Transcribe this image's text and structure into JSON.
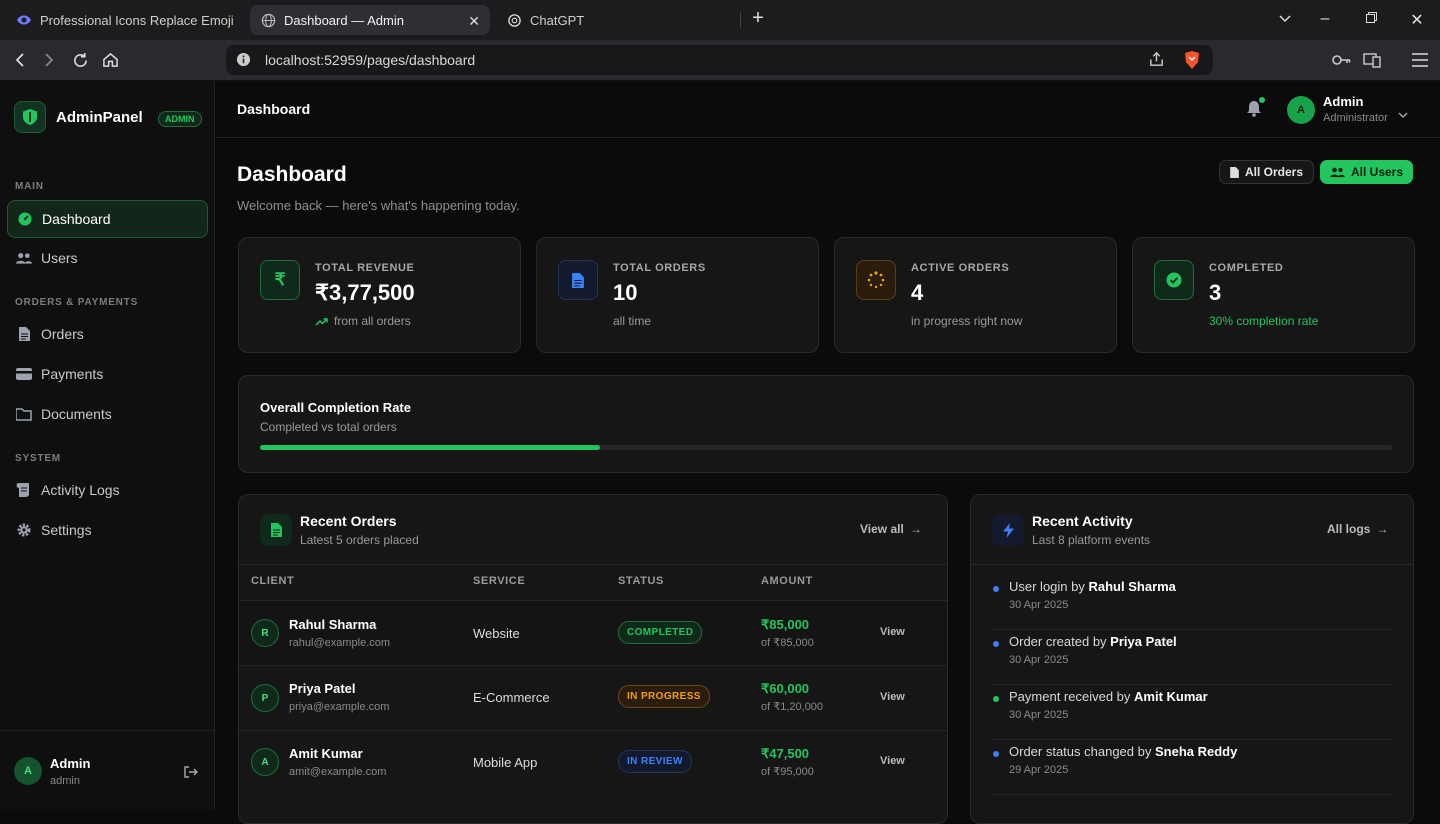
{
  "browser": {
    "tabs": [
      {
        "title": "Professional Icons Replace Emojis - D",
        "active": false
      },
      {
        "title": "Dashboard — Admin",
        "active": true
      },
      {
        "title": "ChatGPT",
        "active": false
      }
    ],
    "url": "localhost:52959/pages/dashboard"
  },
  "sidebar": {
    "brand": "AdminPanel",
    "badge": "ADMIN",
    "sections": {
      "main": "MAIN",
      "orders": "ORDERS & PAYMENTS",
      "system": "SYSTEM"
    },
    "items": {
      "dashboard": "Dashboard",
      "users": "Users",
      "orders": "Orders",
      "payments": "Payments",
      "documents": "Documents",
      "activity": "Activity Logs",
      "settings": "Settings"
    },
    "user": {
      "initial": "A",
      "name": "Admin",
      "role": "admin"
    }
  },
  "topbar": {
    "title": "Dashboard",
    "user_initial": "A",
    "user_name": "Admin",
    "user_role": "Administrator"
  },
  "page": {
    "title": "Dashboard",
    "subtitle": "Welcome back — here's what's happening today.",
    "btn_orders": "All Orders",
    "btn_users": "All Users"
  },
  "stats": [
    {
      "label": "TOTAL REVENUE",
      "value": "₹3,77,500",
      "sub": "from all orders"
    },
    {
      "label": "TOTAL ORDERS",
      "value": "10",
      "sub": "all time"
    },
    {
      "label": "ACTIVE ORDERS",
      "value": "4",
      "sub": "in progress right now"
    },
    {
      "label": "COMPLETED",
      "value": "3",
      "sub": "30% completion rate"
    }
  ],
  "completion": {
    "title": "Overall Completion Rate",
    "subtitle": "Completed vs total orders",
    "percent": 30
  },
  "orders": {
    "title": "Recent Orders",
    "subtitle": "Latest 5 orders placed",
    "view_all": "View all",
    "columns": [
      "CLIENT",
      "SERVICE",
      "STATUS",
      "AMOUNT"
    ],
    "rows": [
      {
        "initial": "R",
        "name": "Rahul Sharma",
        "email": "rahul@example.com",
        "service": "Website",
        "status": "COMPLETED",
        "amount": "₹85,000",
        "of": "of ₹85,000",
        "action": "View"
      },
      {
        "initial": "P",
        "name": "Priya Patel",
        "email": "priya@example.com",
        "service": "E-Commerce",
        "status": "IN PROGRESS",
        "amount": "₹60,000",
        "of": "of ₹1,20,000",
        "action": "View"
      },
      {
        "initial": "A",
        "name": "Amit Kumar",
        "email": "amit@example.com",
        "service": "Mobile App",
        "status": "IN REVIEW",
        "amount": "₹47,500",
        "of": "of ₹95,000",
        "action": "View"
      }
    ]
  },
  "activity": {
    "title": "Recent Activity",
    "subtitle": "Last 8 platform events",
    "all_logs": "All logs",
    "items": [
      {
        "text": "User login by",
        "who": "Rahul Sharma",
        "date": "30 Apr 2025",
        "color": "#3b82f6"
      },
      {
        "text": "Order created by",
        "who": "Priya Patel",
        "date": "30 Apr 2025",
        "color": "#3b82f6"
      },
      {
        "text": "Payment received by",
        "who": "Amit Kumar",
        "date": "30 Apr 2025",
        "color": "#22c55e"
      },
      {
        "text": "Order status changed by",
        "who": "Sneha Reddy",
        "date": "29 Apr 2025",
        "color": "#3b82f6"
      }
    ]
  }
}
